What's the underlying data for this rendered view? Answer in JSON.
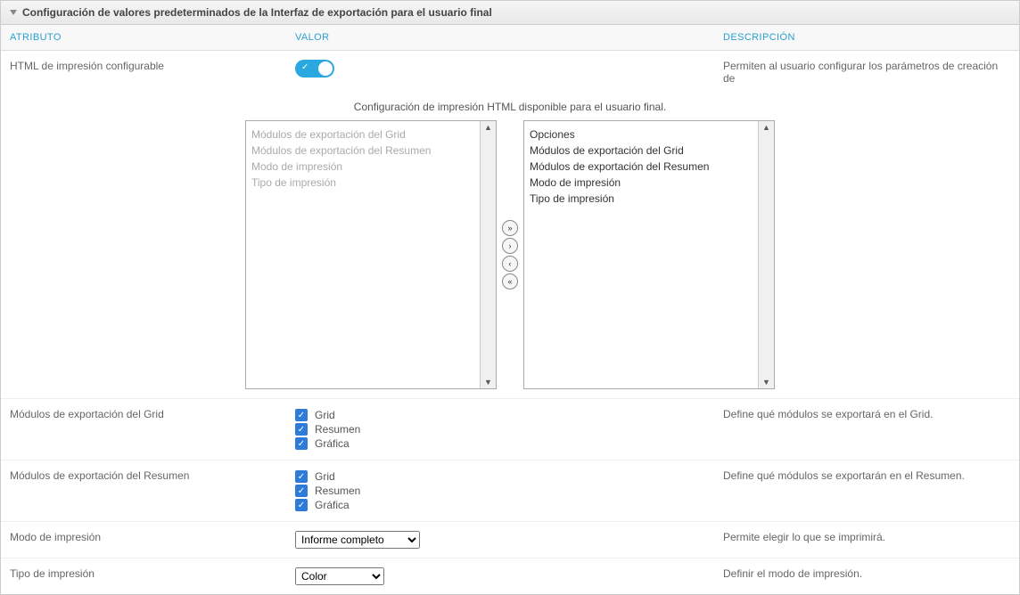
{
  "header": {
    "title": "Configuración de valores predeterminados de la Interfaz de exportación para el usuario final"
  },
  "cols": {
    "attr": "ATRIBUTO",
    "val": "VALOR",
    "desc": "DESCRIPCIÓN"
  },
  "row_html": {
    "attr": "HTML de impresión configurable",
    "desc": "Permiten al usuario configurar los parámetros de creación de"
  },
  "dual": {
    "title": "Configuración de impresión HTML disponible para el usuario final.",
    "left": [
      "Módulos de exportación del Grid",
      "Módulos de exportación del Resumen",
      "Modo de impresión",
      "Tipo de impresión"
    ],
    "right_header": "Opciones",
    "right": [
      "Módulos de exportación del Grid",
      "Módulos de exportación del Resumen",
      "Modo de impresión",
      "Tipo de impresión"
    ]
  },
  "row_grid": {
    "attr": "Módulos de exportación del Grid",
    "opts": [
      "Grid",
      "Resumen",
      "Gráfica"
    ],
    "desc": "Define qué módulos se exportará en el Grid."
  },
  "row_res": {
    "attr": "Módulos de exportación del Resumen",
    "opts": [
      "Grid",
      "Resumen",
      "Gráfica"
    ],
    "desc": "Define qué módulos se exportarán en el Resumen."
  },
  "row_modo": {
    "attr": "Modo de impresión",
    "selected": "Informe completo",
    "desc": "Permite elegir lo que se imprimirá."
  },
  "row_tipo": {
    "attr": "Tipo de impresión",
    "selected": "Color",
    "desc": "Definir el modo de impresión."
  }
}
